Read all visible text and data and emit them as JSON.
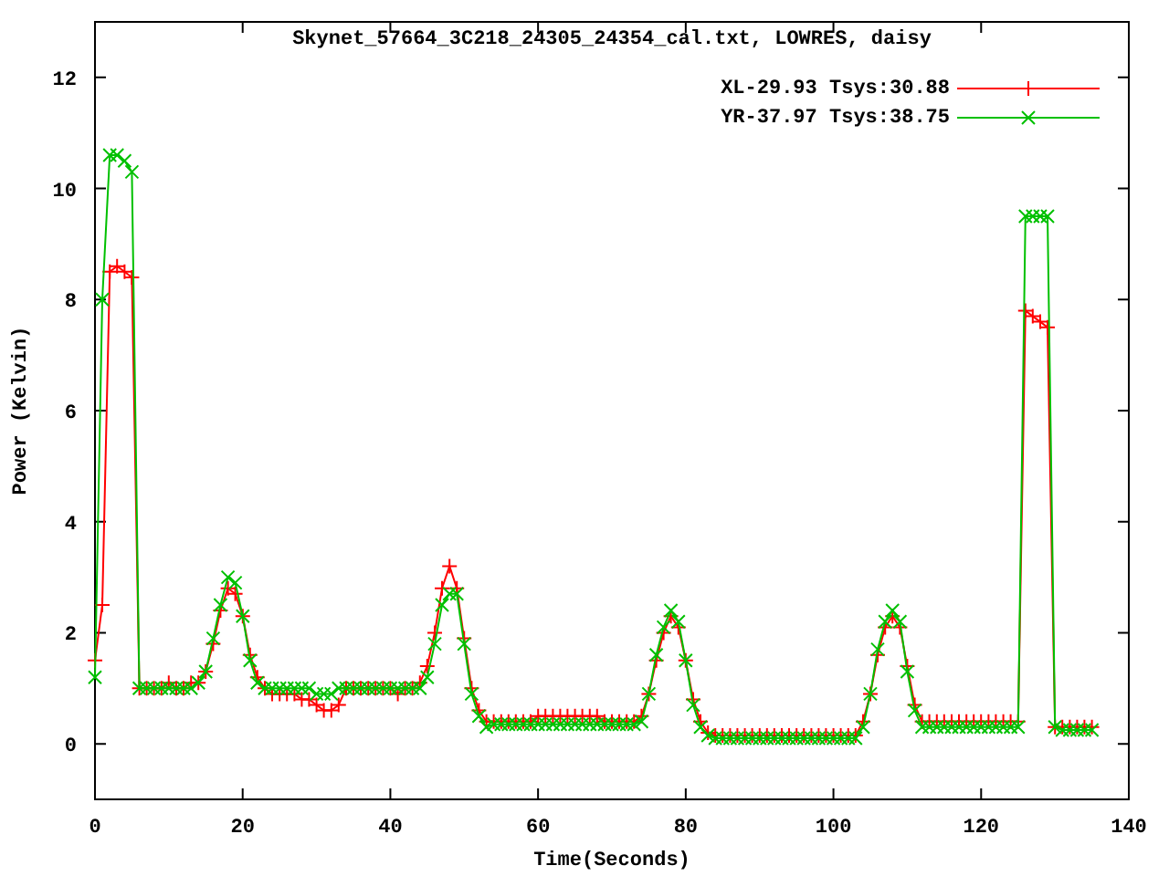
{
  "chart": {
    "chart_data": {
      "type": "line",
      "title": "Skynet_57664_3C218_24305_24354_cal.txt, LOWRES, daisy",
      "xlabel": "Time(Seconds)",
      "ylabel": "Power (Kelvin)",
      "xlim": [
        0,
        140
      ],
      "ylim": [
        -1,
        13
      ],
      "xticks": [
        0,
        20,
        40,
        60,
        80,
        100,
        120,
        140
      ],
      "yticks": [
        0,
        2,
        4,
        6,
        8,
        10,
        12
      ],
      "x": [
        0,
        1,
        2,
        3,
        4,
        5,
        6,
        7,
        8,
        9,
        10,
        11,
        12,
        13,
        14,
        15,
        16,
        17,
        18,
        19,
        20,
        21,
        22,
        23,
        24,
        25,
        26,
        27,
        28,
        29,
        30,
        31,
        32,
        33,
        34,
        35,
        36,
        37,
        38,
        39,
        40,
        41,
        42,
        43,
        44,
        45,
        46,
        47,
        48,
        49,
        50,
        51,
        52,
        53,
        54,
        55,
        56,
        57,
        58,
        59,
        60,
        61,
        62,
        63,
        64,
        65,
        66,
        67,
        68,
        69,
        70,
        71,
        72,
        73,
        74,
        75,
        76,
        77,
        78,
        79,
        80,
        81,
        82,
        83,
        84,
        85,
        86,
        87,
        88,
        89,
        90,
        91,
        92,
        93,
        94,
        95,
        96,
        97,
        98,
        99,
        100,
        101,
        102,
        103,
        104,
        105,
        106,
        107,
        108,
        109,
        110,
        111,
        112,
        113,
        114,
        115,
        116,
        117,
        118,
        119,
        120,
        121,
        122,
        123,
        124,
        125,
        126,
        127,
        128,
        129,
        130,
        131,
        132,
        133,
        134,
        135
      ],
      "series": [
        {
          "name": "XL-29.93 Tsys:30.88",
          "color": "#ff0000",
          "marker": "plus",
          "values": [
            1.5,
            2.5,
            8.5,
            8.6,
            8.5,
            8.4,
            1.0,
            1.0,
            1.0,
            1.0,
            1.1,
            1.0,
            1.0,
            1.1,
            1.1,
            1.3,
            1.8,
            2.4,
            2.8,
            2.7,
            2.3,
            1.6,
            1.2,
            1.0,
            0.9,
            0.9,
            0.9,
            0.9,
            0.8,
            0.8,
            0.7,
            0.6,
            0.6,
            0.7,
            1.0,
            1.0,
            1.0,
            1.0,
            1.0,
            1.0,
            1.0,
            0.9,
            1.0,
            1.0,
            1.1,
            1.4,
            2.0,
            2.8,
            3.2,
            2.8,
            1.9,
            1.0,
            0.6,
            0.4,
            0.4,
            0.4,
            0.4,
            0.4,
            0.4,
            0.4,
            0.5,
            0.5,
            0.5,
            0.5,
            0.5,
            0.5,
            0.5,
            0.5,
            0.5,
            0.4,
            0.4,
            0.4,
            0.4,
            0.4,
            0.5,
            0.9,
            1.5,
            2.0,
            2.3,
            2.1,
            1.5,
            0.8,
            0.4,
            0.2,
            0.15,
            0.15,
            0.15,
            0.15,
            0.15,
            0.15,
            0.15,
            0.15,
            0.15,
            0.15,
            0.15,
            0.15,
            0.15,
            0.15,
            0.15,
            0.15,
            0.15,
            0.15,
            0.15,
            0.15,
            0.4,
            0.9,
            1.6,
            2.1,
            2.3,
            2.1,
            1.4,
            0.7,
            0.4,
            0.4,
            0.4,
            0.4,
            0.4,
            0.4,
            0.4,
            0.4,
            0.4,
            0.4,
            0.4,
            0.4,
            0.4,
            0.4,
            7.8,
            7.7,
            7.6,
            7.5,
            0.3,
            0.3,
            0.3,
            0.3,
            0.3,
            0.3
          ]
        },
        {
          "name": "YR-37.97 Tsys:38.75",
          "color": "#00c000",
          "marker": "cross",
          "values": [
            1.2,
            8.0,
            10.6,
            10.6,
            10.5,
            10.3,
            1.0,
            1.0,
            1.0,
            1.0,
            1.0,
            1.0,
            1.0,
            1.0,
            1.1,
            1.3,
            1.9,
            2.5,
            3.0,
            2.9,
            2.3,
            1.5,
            1.1,
            1.0,
            1.0,
            1.0,
            1.0,
            1.0,
            1.0,
            1.0,
            0.9,
            0.9,
            0.9,
            1.0,
            1.0,
            1.0,
            1.0,
            1.0,
            1.0,
            1.0,
            1.0,
            1.0,
            1.0,
            1.0,
            1.0,
            1.2,
            1.8,
            2.5,
            2.7,
            2.7,
            1.8,
            0.9,
            0.5,
            0.3,
            0.35,
            0.35,
            0.35,
            0.35,
            0.35,
            0.35,
            0.35,
            0.35,
            0.35,
            0.35,
            0.35,
            0.35,
            0.35,
            0.35,
            0.35,
            0.35,
            0.35,
            0.35,
            0.35,
            0.35,
            0.4,
            0.9,
            1.6,
            2.1,
            2.4,
            2.2,
            1.5,
            0.7,
            0.3,
            0.15,
            0.1,
            0.1,
            0.1,
            0.1,
            0.1,
            0.1,
            0.1,
            0.1,
            0.1,
            0.1,
            0.1,
            0.1,
            0.1,
            0.1,
            0.1,
            0.1,
            0.1,
            0.1,
            0.1,
            0.1,
            0.3,
            0.9,
            1.7,
            2.2,
            2.4,
            2.2,
            1.3,
            0.6,
            0.3,
            0.3,
            0.3,
            0.3,
            0.3,
            0.3,
            0.3,
            0.3,
            0.3,
            0.3,
            0.3,
            0.3,
            0.3,
            0.3,
            9.5,
            9.5,
            9.5,
            9.5,
            0.3,
            0.25,
            0.25,
            0.25,
            0.25,
            0.25
          ]
        }
      ]
    }
  }
}
